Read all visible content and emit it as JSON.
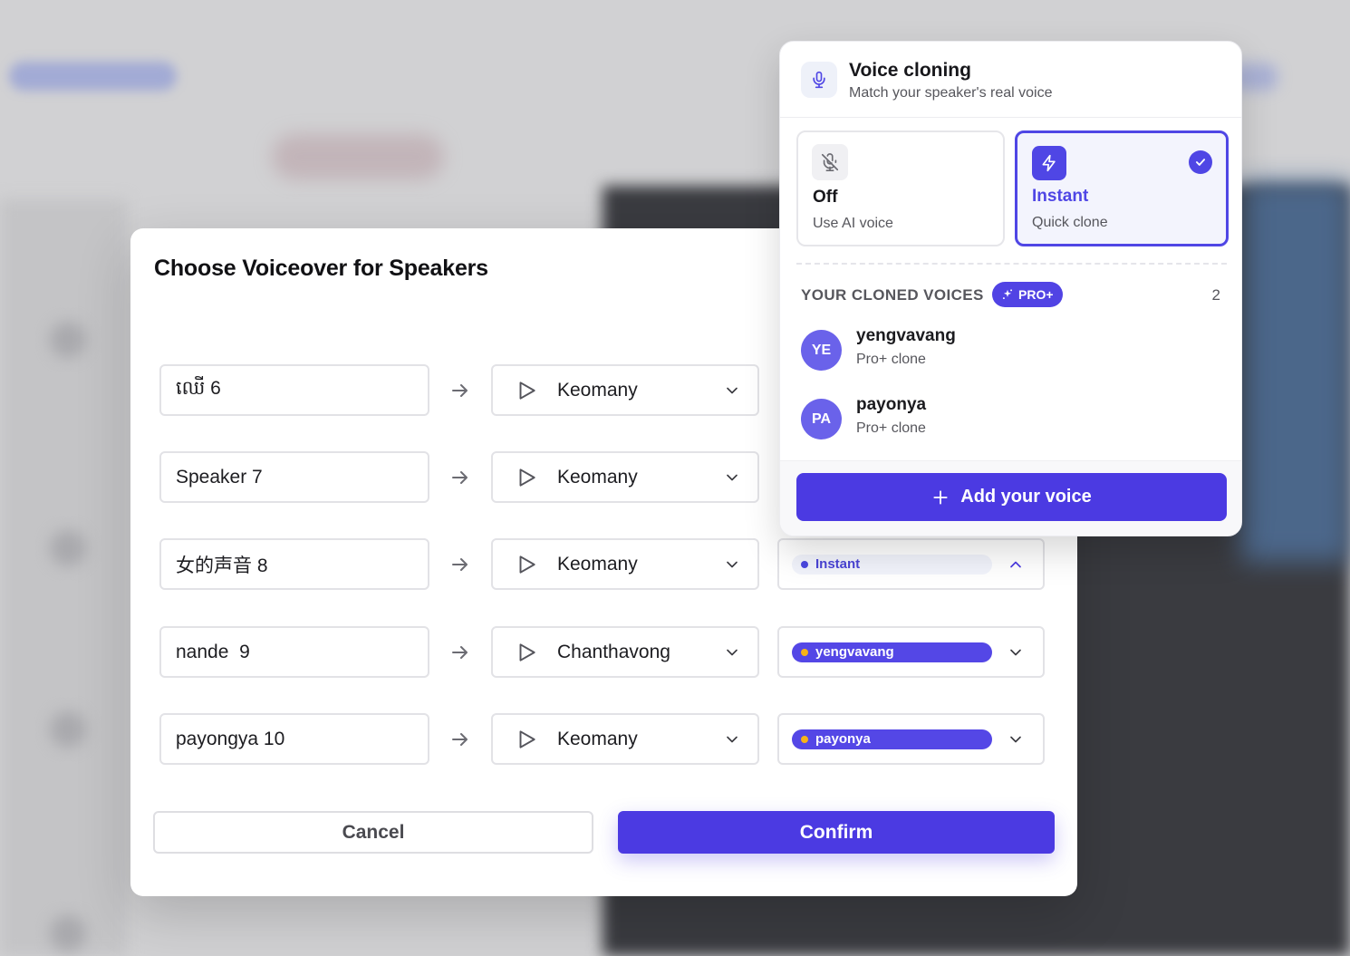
{
  "dialog": {
    "title": "Choose Voiceover for Speakers",
    "rows": [
      {
        "speaker": "ឈើ 6",
        "voice": "Keomany",
        "clone": null
      },
      {
        "speaker": "Speaker 7",
        "voice": "Keomany",
        "clone": null
      },
      {
        "speaker": "女的声音 8",
        "voice": "Keomany",
        "clone": "Instant"
      },
      {
        "speaker": "nande  9",
        "voice": "Chanthavong",
        "clone": "yengvavang"
      },
      {
        "speaker": "payongya 10",
        "voice": "Keomany",
        "clone": "payonya"
      }
    ],
    "cancel_label": "Cancel",
    "confirm_label": "Confirm"
  },
  "popover": {
    "title": "Voice cloning",
    "subtitle": "Match your speaker's real voice",
    "options": {
      "off": {
        "title": "Off",
        "desc": "Use AI voice",
        "icon": "mic-off-icon"
      },
      "instant": {
        "title": "Instant",
        "desc": "Quick clone",
        "icon": "lightning-icon",
        "selected": true
      }
    },
    "section_label": "YOUR CLONED VOICES",
    "pro_badge": "PRO+",
    "count": "2",
    "voices": [
      {
        "initials": "YE",
        "name": "yengvavang",
        "sub": "Pro+ clone"
      },
      {
        "initials": "PA",
        "name": "payonya",
        "sub": "Pro+ clone"
      }
    ],
    "add_voice_label": "Add your voice"
  },
  "colors": {
    "accent": "#4b3ae2",
    "accent_light": "#f3f4fd",
    "badge_dot": "#f7b318"
  }
}
